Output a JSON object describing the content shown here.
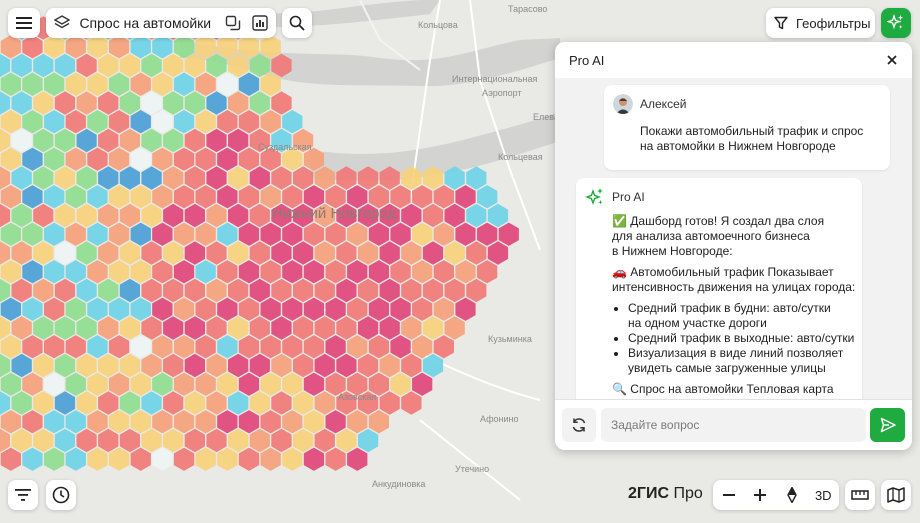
{
  "toolbar": {
    "layer_title": "Спрос на автомойки",
    "geofilters_label": "Геофильтры"
  },
  "map": {
    "city_label": "Нижний Новгород",
    "labels": [
      "Тарасово",
      "Елева",
      "Кузьминка",
      "Афонино",
      "Утечино",
      "Анкудиновка",
      "Кольцова",
      "Интернациональная",
      "Аэропорт",
      "Кольцевая",
      "Суздальская",
      "Азовская"
    ],
    "brand_main": "2ГИС",
    "brand_sub": "Про",
    "three_d_label": "3D",
    "heat_colors": [
      "#e0457a",
      "#f07a77",
      "#f5a07a",
      "#f7d07c",
      "#8fdc8f",
      "#6ed3e8",
      "#4a9fd6",
      "#eef3f5"
    ]
  },
  "chat": {
    "title": "Pro AI",
    "user": {
      "name": "Алексей",
      "message": [
        "Покажи автомобильный трафик и спрос",
        "на автомойки в Нижнем Новгороде"
      ]
    },
    "ai": {
      "name": "Pro AI",
      "intro": [
        "✅ Дашборд готов! Я создал два слоя",
        "для анализа автомоечного бизнеса",
        "в Нижнем Новгороде:"
      ],
      "traffic_heading": [
        "🚗 Автомобильный трафик Показывает",
        "интенсивность движения на улицах города:"
      ],
      "bullets": [
        [
          "Средний трафик в будни: авто/сутки",
          "на одном участке дороги"
        ],
        [
          "Средний трафик в выходные: авто/сутки"
        ],
        [
          "Визуализация в виде линий позволяет",
          "увидеть самые загруженные улицы"
        ]
      ],
      "demand_heading": [
        "🔍 Спрос на автомойки Тепловая карта"
      ]
    },
    "input_placeholder": "Задайте вопрос"
  }
}
